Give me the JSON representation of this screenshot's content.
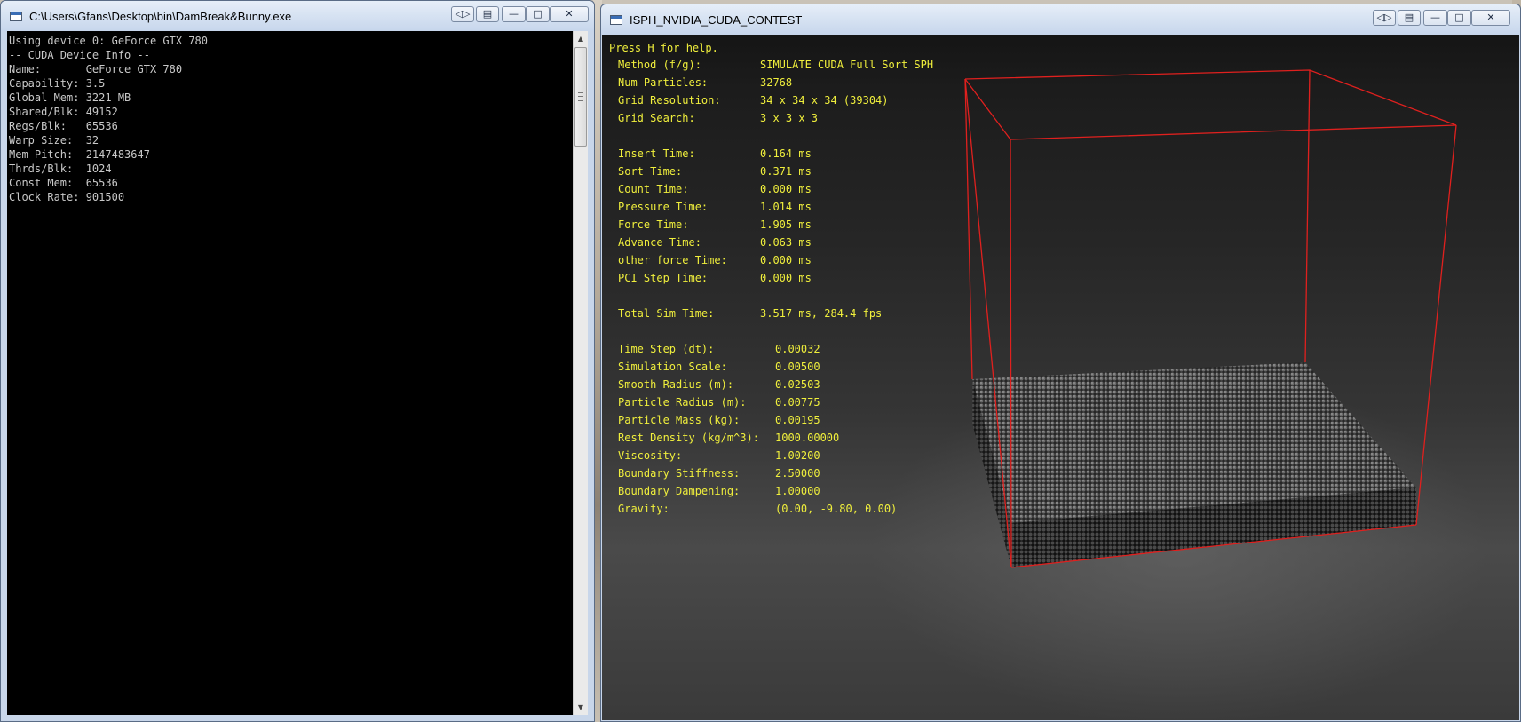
{
  "console_window": {
    "title": "C:\\Users\\Gfans\\Desktop\\bin\\DamBreak&Bunny.exe",
    "lines": [
      "Using device 0: GeForce GTX 780",
      "-- CUDA Device Info --",
      "Name:       GeForce GTX 780",
      "Capability: 3.5",
      "Global Mem: 3221 MB",
      "Shared/Blk: 49152",
      "Regs/Blk:   65536",
      "Warp Size:  32",
      "Mem Pitch:  2147483647",
      "Thrds/Blk:  1024",
      "Const Mem:  65536",
      "Clock Rate: 901500"
    ]
  },
  "sim_window": {
    "title": "ISPH_NVIDIA_CUDA_CONTEST",
    "help_text": "Press H for help.",
    "stats": [
      {
        "label": "Method (f/g):",
        "value": "SIMULATE CUDA Full Sort SPH"
      },
      {
        "label": "Num Particles:",
        "value": "32768"
      },
      {
        "label": "Grid Resolution:",
        "value": "34 x 34 x 34 (39304)"
      },
      {
        "label": "Grid Search:",
        "value": "3 x 3 x 3"
      },
      {
        "label": "Insert Time:",
        "value": "0.164 ms"
      },
      {
        "label": "Sort Time:",
        "value": "0.371 ms"
      },
      {
        "label": "Count Time:",
        "value": "0.000 ms"
      },
      {
        "label": "Pressure Time:",
        "value": "1.014 ms"
      },
      {
        "label": "Force Time:",
        "value": "1.905 ms"
      },
      {
        "label": "Advance Time:",
        "value": "0.063 ms"
      },
      {
        "label": "other force Time:",
        "value": "0.000 ms"
      },
      {
        "label": "PCI Step Time:",
        "value": "0.000 ms"
      },
      {
        "label": "Total Sim Time:",
        "value": "3.517 ms, 284.4 fps"
      },
      {
        "label": "Time Step (dt):",
        "value": "0.00032"
      },
      {
        "label": "Simulation Scale:",
        "value": "0.00500"
      },
      {
        "label": "Smooth Radius (m):",
        "value": "0.02503"
      },
      {
        "label": "Particle Radius (m):",
        "value": "0.00775"
      },
      {
        "label": "Particle Mass (kg):",
        "value": "0.00195"
      },
      {
        "label": "Rest Density (kg/m^3):",
        "value": "1000.00000"
      },
      {
        "label": "Viscosity:",
        "value": "1.00200"
      },
      {
        "label": "Boundary Stiffness:",
        "value": "2.50000"
      },
      {
        "label": "Boundary Dampening:",
        "value": "1.00000"
      },
      {
        "label": "Gravity:",
        "value": "(0.00, -9.80, 0.00)"
      }
    ]
  },
  "colors": {
    "hud_text": "#f0ef3c",
    "boundary_box": "#e0201e",
    "console_bg": "#000000"
  },
  "icons": [
    "console-app-icon",
    "sim-app-icon",
    "minimize-icon",
    "maximize-icon",
    "close-icon",
    "scroll-up-icon",
    "scroll-down-icon"
  ]
}
